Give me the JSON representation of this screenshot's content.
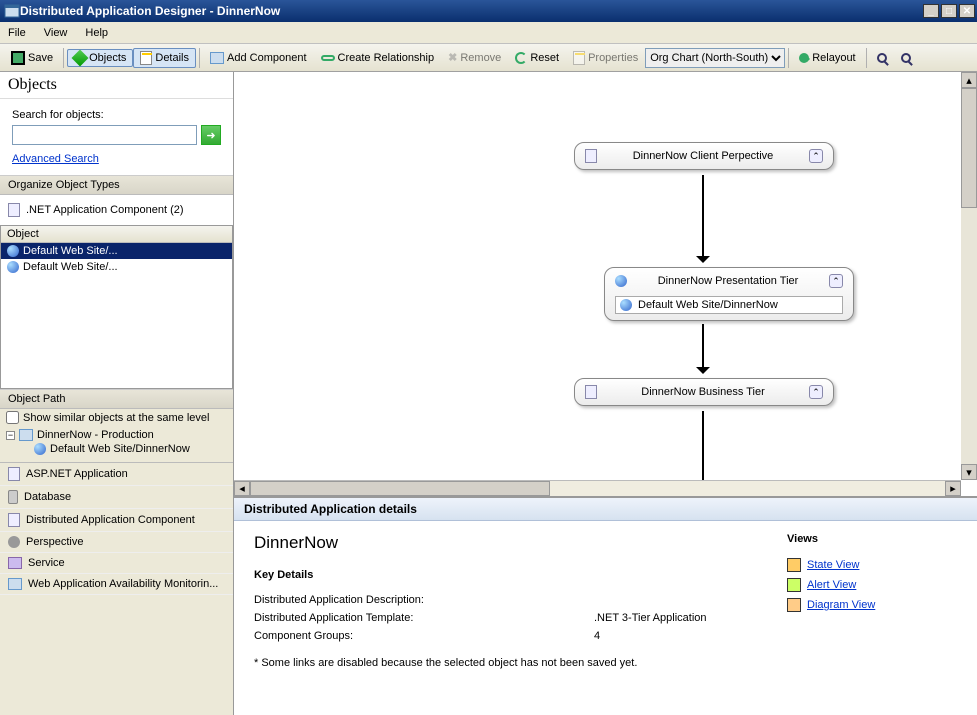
{
  "window": {
    "title": "Distributed Application Designer - DinnerNow"
  },
  "menu": {
    "file": "File",
    "view": "View",
    "help": "Help"
  },
  "toolbar": {
    "save": "Save",
    "objects": "Objects",
    "details": "Details",
    "add_component": "Add Component",
    "create_rel": "Create Relationship",
    "remove": "Remove",
    "reset": "Reset",
    "properties": "Properties",
    "layout_dd": "Org Chart (North-South)",
    "relayout": "Relayout"
  },
  "objects_panel": {
    "title": "Objects",
    "search_label": "Search for objects:",
    "search_value": "",
    "adv_search": "Advanced Search",
    "organize_hdr": "Organize Object Types",
    "type_item": ".NET Application Component (2)",
    "grid_hdr": "Object",
    "grid_rows": [
      "Default Web Site/...",
      "Default Web Site/..."
    ],
    "path_hdr": "Object Path",
    "show_similar": "Show similar objects at the same level",
    "tree_root": "DinnerNow - Production",
    "tree_child": "Default Web Site/DinnerNow",
    "bottom_items": [
      "ASP.NET Application",
      "Database",
      "Distributed Application Component",
      "Perspective",
      "Service",
      "Web Application Availability Monitorin..."
    ]
  },
  "diagram": {
    "node1": "DinnerNow   Client Perpective",
    "node2": "DinnerNow   Presentation Tier",
    "node2_child": "Default   Web   Site/DinnerNow",
    "node3": "DinnerNow   Business Tier"
  },
  "details": {
    "header": "Distributed Application details",
    "app_name": "DinnerNow",
    "key_details": "Key Details",
    "rows": [
      {
        "label": "Distributed Application Description:",
        "value": ""
      },
      {
        "label": "Distributed Application Template:",
        "value": ".NET 3-Tier Application"
      },
      {
        "label": "Component Groups:",
        "value": "4"
      }
    ],
    "note": "* Some links are disabled because the selected object has not been saved yet.",
    "views_title": "Views",
    "views": [
      "State View",
      "Alert View",
      "Diagram View"
    ]
  }
}
